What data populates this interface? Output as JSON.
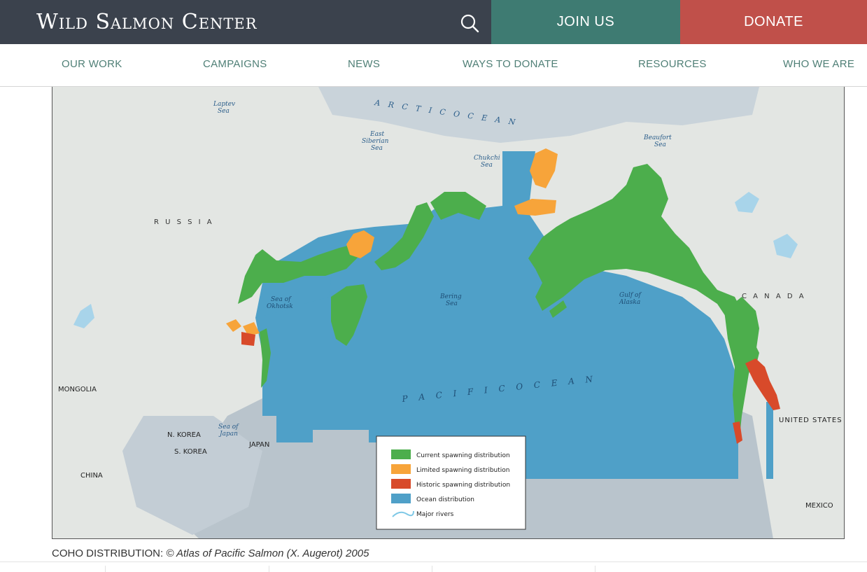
{
  "header": {
    "logo_text": "Wild Salmon Center",
    "search_icon": "search-icon",
    "join_label": "JOIN US",
    "donate_label": "DONATE",
    "colors": {
      "bar": "#3b424d",
      "join": "#3e7b72",
      "donate": "#c0504a",
      "nav_text": "#4f7f76"
    }
  },
  "nav": {
    "items": [
      "OUR WORK",
      "CAMPAIGNS",
      "NEWS",
      "WAYS TO DONATE",
      "RESOURCES",
      "WHO WE ARE"
    ]
  },
  "map": {
    "labels": {
      "arctic_ocean": "A R C T I C   O C E A N",
      "pacific_ocean": "P A C I F I C   O C E A N",
      "laptev_1": "Laptev",
      "laptev_2": "Sea",
      "east_sib_1": "East",
      "east_sib_2": "Siberian",
      "east_sib_3": "Sea",
      "chukchi_1": "Chukchi",
      "chukchi_2": "Sea",
      "beaufort_1": "Beaufort",
      "beaufort_2": "Sea",
      "russia": "R U S S I A",
      "canada": "C A N A D A",
      "okhotsk_1": "Sea of",
      "okhotsk_2": "Okhotsk",
      "bering_1": "Bering",
      "bering_2": "Sea",
      "alaska_1": "Gulf of",
      "alaska_2": "Alaska",
      "mongolia": "MONGOLIA",
      "n_korea": "N. KOREA",
      "s_korea": "S. KOREA",
      "japan": "JAPAN",
      "japan_sea_1": "Sea of",
      "japan_sea_2": "Japan",
      "china": "CHINA",
      "united_states": "UNITED STATES",
      "mexico": "MEXICO"
    },
    "legend": {
      "items": [
        {
          "label": "Current spawning distribution",
          "color": "#4cae4c"
        },
        {
          "label": "Limited spawning distribution",
          "color": "#f7a43a"
        },
        {
          "label": "Historic spawning distribution",
          "color": "#d84a2a"
        },
        {
          "label": "Ocean distribution",
          "color": "#4fa0c8"
        }
      ],
      "rivers_label": "Major rivers",
      "rivers_color": "#7ec8e6"
    }
  },
  "caption": {
    "prefix": "COHO DISTRIBUTION: ",
    "source": "© Atlas of Pacific Salmon (X. Augerot) 2005"
  }
}
